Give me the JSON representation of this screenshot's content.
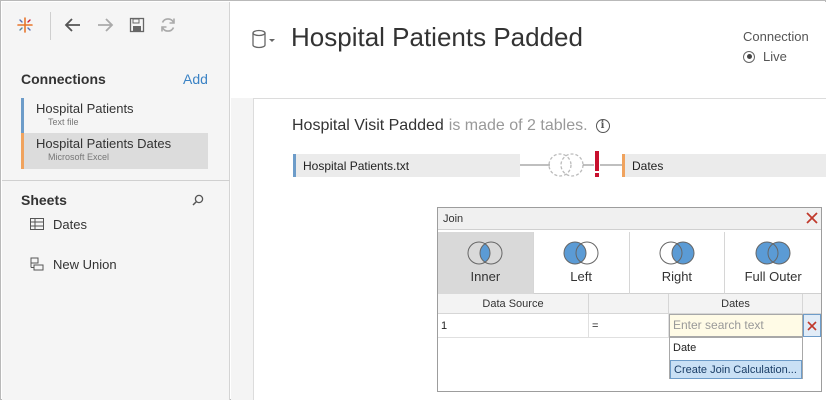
{
  "toolbar": {
    "icons": [
      "tableau-logo-icon",
      "back-arrow-icon",
      "forward-arrow-icon",
      "save-icon",
      "refresh-icon"
    ]
  },
  "sidebar": {
    "connections_header": "Connections",
    "add_label": "Add",
    "connections": [
      {
        "name": "Hospital Patients",
        "type": "Text file",
        "color": "#6d9cc9"
      },
      {
        "name": "Hospital Patients Dates",
        "type": "Microsoft Excel",
        "color": "#f0a35e"
      }
    ],
    "sheets_header": "Sheets",
    "sheets": [
      {
        "name": "Dates",
        "icon": "table-grid-icon"
      },
      {
        "name": "New Union",
        "icon": "union-icon"
      }
    ]
  },
  "header": {
    "title": "Hospital Patients Padded",
    "connection_label": "Connection",
    "live_label": "Live"
  },
  "canvas": {
    "ds_name": "Hospital Visit Padded",
    "made_of_text": "is made of 2 tables.",
    "tables": [
      {
        "name": "Hospital Patients.txt",
        "color": "#6d9cc9"
      },
      {
        "name": "Dates",
        "color": "#f0a35e"
      }
    ]
  },
  "join_dialog": {
    "title": "Join",
    "join_types": [
      {
        "label": "Inner",
        "selected": true
      },
      {
        "label": "Left",
        "selected": false
      },
      {
        "label": "Right",
        "selected": false
      },
      {
        "label": "Full Outer",
        "selected": false
      }
    ],
    "columns": {
      "data_source": "Data Source",
      "dates": "Dates"
    },
    "row": {
      "left": "1",
      "operator": "="
    },
    "search_placeholder": "Enter search text",
    "dropdown_items": [
      "Date",
      "Create Join Calculation..."
    ]
  },
  "colors": {
    "accent_blue": "#6d9cc9",
    "accent_orange": "#f0a35e",
    "venn_fill": "#5b9bd5",
    "error_red": "#c8102e"
  }
}
